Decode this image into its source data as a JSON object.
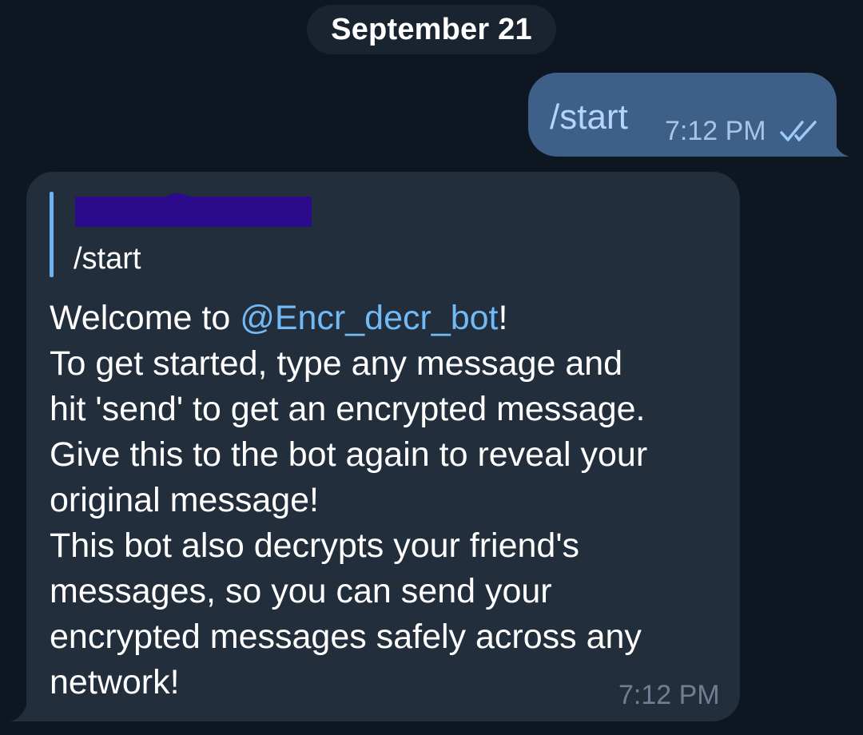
{
  "date_separator": "September 21",
  "outgoing": {
    "text": "/start",
    "time": "7:12 PM",
    "status_icon": "double-check-icon"
  },
  "incoming": {
    "reply": {
      "sender": "[redacted]",
      "text": "/start"
    },
    "lines": [
      {
        "before": "Welcome to ",
        "mention": "@Encr_decr_bot",
        "after": "!"
      },
      {
        "text": "To get started, type any message and"
      },
      {
        "text": "hit 'send' to get an encrypted message."
      },
      {
        "text": "Give this to the bot again to reveal your"
      },
      {
        "text": "original message!"
      },
      {
        "text": "This bot also decrypts your friend's"
      },
      {
        "text": "messages, so you can send your"
      },
      {
        "text": "encrypted messages safely across any"
      },
      {
        "text": "network!"
      }
    ],
    "time": "7:12 PM"
  },
  "colors": {
    "background": "#0e1621",
    "outgoing_bubble": "#3e5f87",
    "incoming_bubble": "#222e3c",
    "mention": "#71baf5",
    "reply_bar": "#6ab2f2",
    "redaction": "#2c0a8c"
  }
}
